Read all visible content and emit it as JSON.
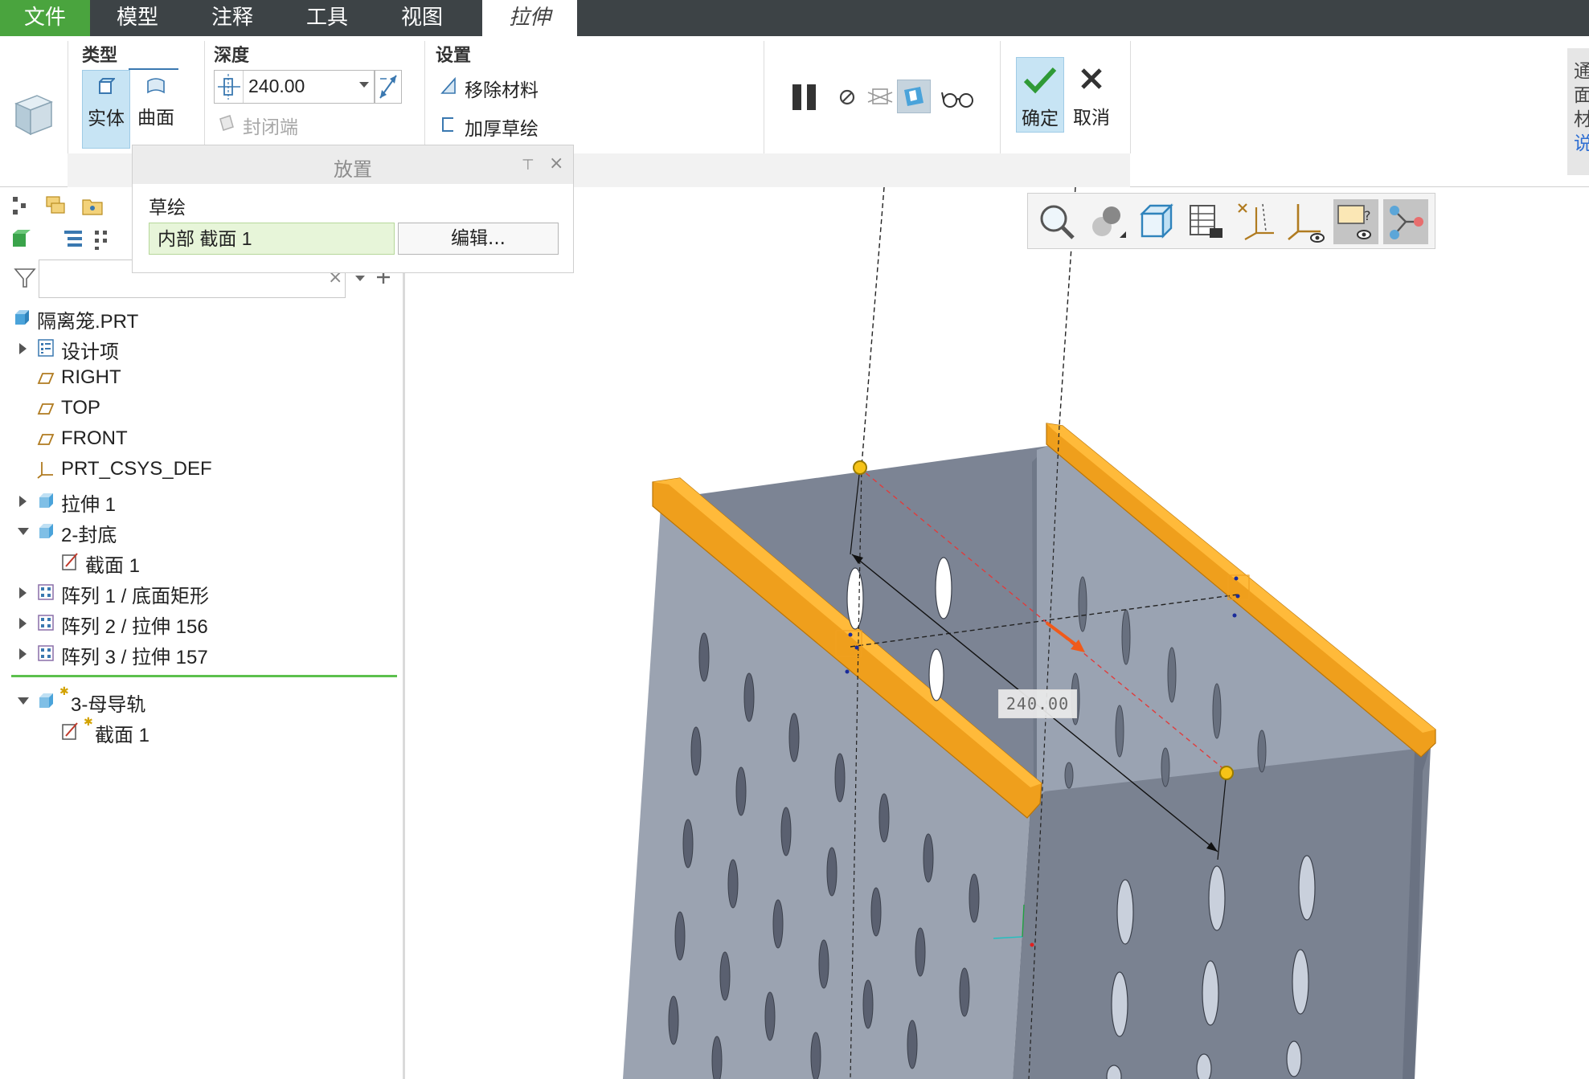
{
  "menu": {
    "file": "文件",
    "model": "模型",
    "annotate": "注释",
    "tools": "工具",
    "view": "视图",
    "extrude": "拉伸"
  },
  "ribbon": {
    "type_label": "类型",
    "solid_label": "实体",
    "surface_label": "曲面",
    "depth_label": "深度",
    "depth_value": "240.00",
    "capped_ends_label": "封闭端",
    "settings_label": "设置",
    "remove_material_label": "移除材料",
    "thicken_sketch_label": "加厚草绘",
    "ok_label": "确定",
    "cancel_label": "取消"
  },
  "right_panel": {
    "line1": "通",
    "line2": "面",
    "line3": "材",
    "link": "说"
  },
  "placement_popup": {
    "title": "放置",
    "sketch_label": "草绘",
    "sketch_value": "内部 截面 1",
    "edit_button": "编辑..."
  },
  "model_tree": {
    "filter_placeholder": "",
    "items": [
      {
        "label": "隔离笼.PRT"
      },
      {
        "label": "设计项"
      },
      {
        "label": "RIGHT"
      },
      {
        "label": "TOP"
      },
      {
        "label": "FRONT"
      },
      {
        "label": "PRT_CSYS_DEF"
      },
      {
        "label": "拉伸 1"
      },
      {
        "label": "2-封底"
      },
      {
        "label": "截面 1"
      },
      {
        "label": "阵列 1 / 底面矩形"
      },
      {
        "label": "阵列 2 / 拉伸 156"
      },
      {
        "label": "阵列 3 / 拉伸 157"
      },
      {
        "label": "3-母导轨"
      },
      {
        "label": "截面 1"
      }
    ]
  },
  "viewport": {
    "dimension_value": "240.00"
  },
  "colors": {
    "menubar": "#3d4346",
    "file_tab": "#4aa43e",
    "active_button": "#c7e4f4",
    "rail": "#f0a020",
    "part_gray": "#8d97a6",
    "insert_line": "#5cc04d"
  },
  "icons": {
    "feature": "extrude-feature-icon",
    "solid": "solid-icon",
    "surface": "surface-icon",
    "pause": "pause-icon",
    "ok": "checkmark-icon",
    "cancel": "close-icon"
  }
}
